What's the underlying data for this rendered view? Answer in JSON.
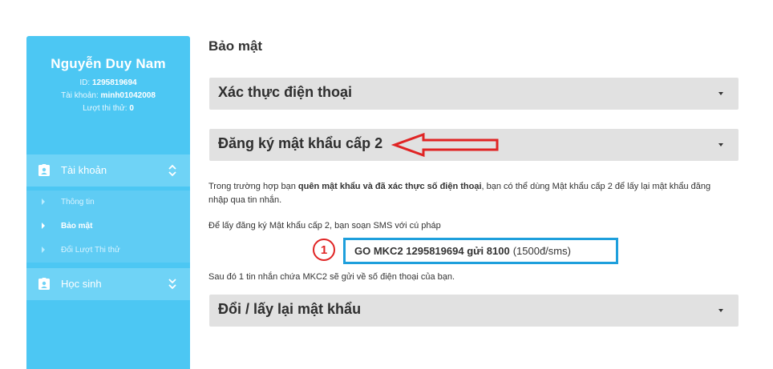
{
  "sidebar": {
    "profile": {
      "name": "Nguyễn Duy Nam",
      "id_label": "ID:",
      "id_value": "1295819694",
      "account_label": "Tài khoản:",
      "account_value": "minh01042008",
      "tries_label": "Lượt thi thử:",
      "tries_value": "0"
    },
    "groups": [
      {
        "label": "Tài khoản",
        "icon": "id-card-icon",
        "chevron": "chevron-up-icon"
      },
      {
        "label": "Học sinh",
        "icon": "id-card-icon",
        "chevron": "chevron-down-icon"
      }
    ],
    "sub_items": [
      {
        "label": "Thông tin"
      },
      {
        "label": "Bảo mật"
      },
      {
        "label": "Đổi Lượt Thi thử"
      }
    ]
  },
  "main": {
    "title": "Bảo mật",
    "sections": [
      {
        "label": "Xác thực điện thoại"
      },
      {
        "label": "Đăng ký mật khẩu cấp 2"
      },
      {
        "label": "Đổi / lấy lại mật khẩu"
      }
    ],
    "intro": {
      "part1": "Trong trường hợp bạn ",
      "bold": "quên mật khẩu và đã xác thực số điện thoại",
      "part2": ", bạn có thể dùng Mật khẩu cấp 2 để lấy lại mật khẩu đăng nhập qua tin nhắn."
    },
    "instruction": "Để lấy đăng ký Mật khẩu cấp 2, bạn soạn SMS với cú pháp",
    "sms": {
      "code": "GO MKC2 1295819694 gửi 8100",
      "price": "(1500đ/sms)"
    },
    "after_note": "Sau đó 1 tin nhắn chứa MKC2 sẽ gửi về số điện thoại của bạn.",
    "annotation_badge": "1"
  },
  "colors": {
    "sidebar_bg": "#4cc7f3",
    "sidebar_active": "#6fd3f6",
    "accordion_bg": "#e1e1e1",
    "annotation_red": "#e02424",
    "sms_box_border": "#1e9fdc"
  }
}
